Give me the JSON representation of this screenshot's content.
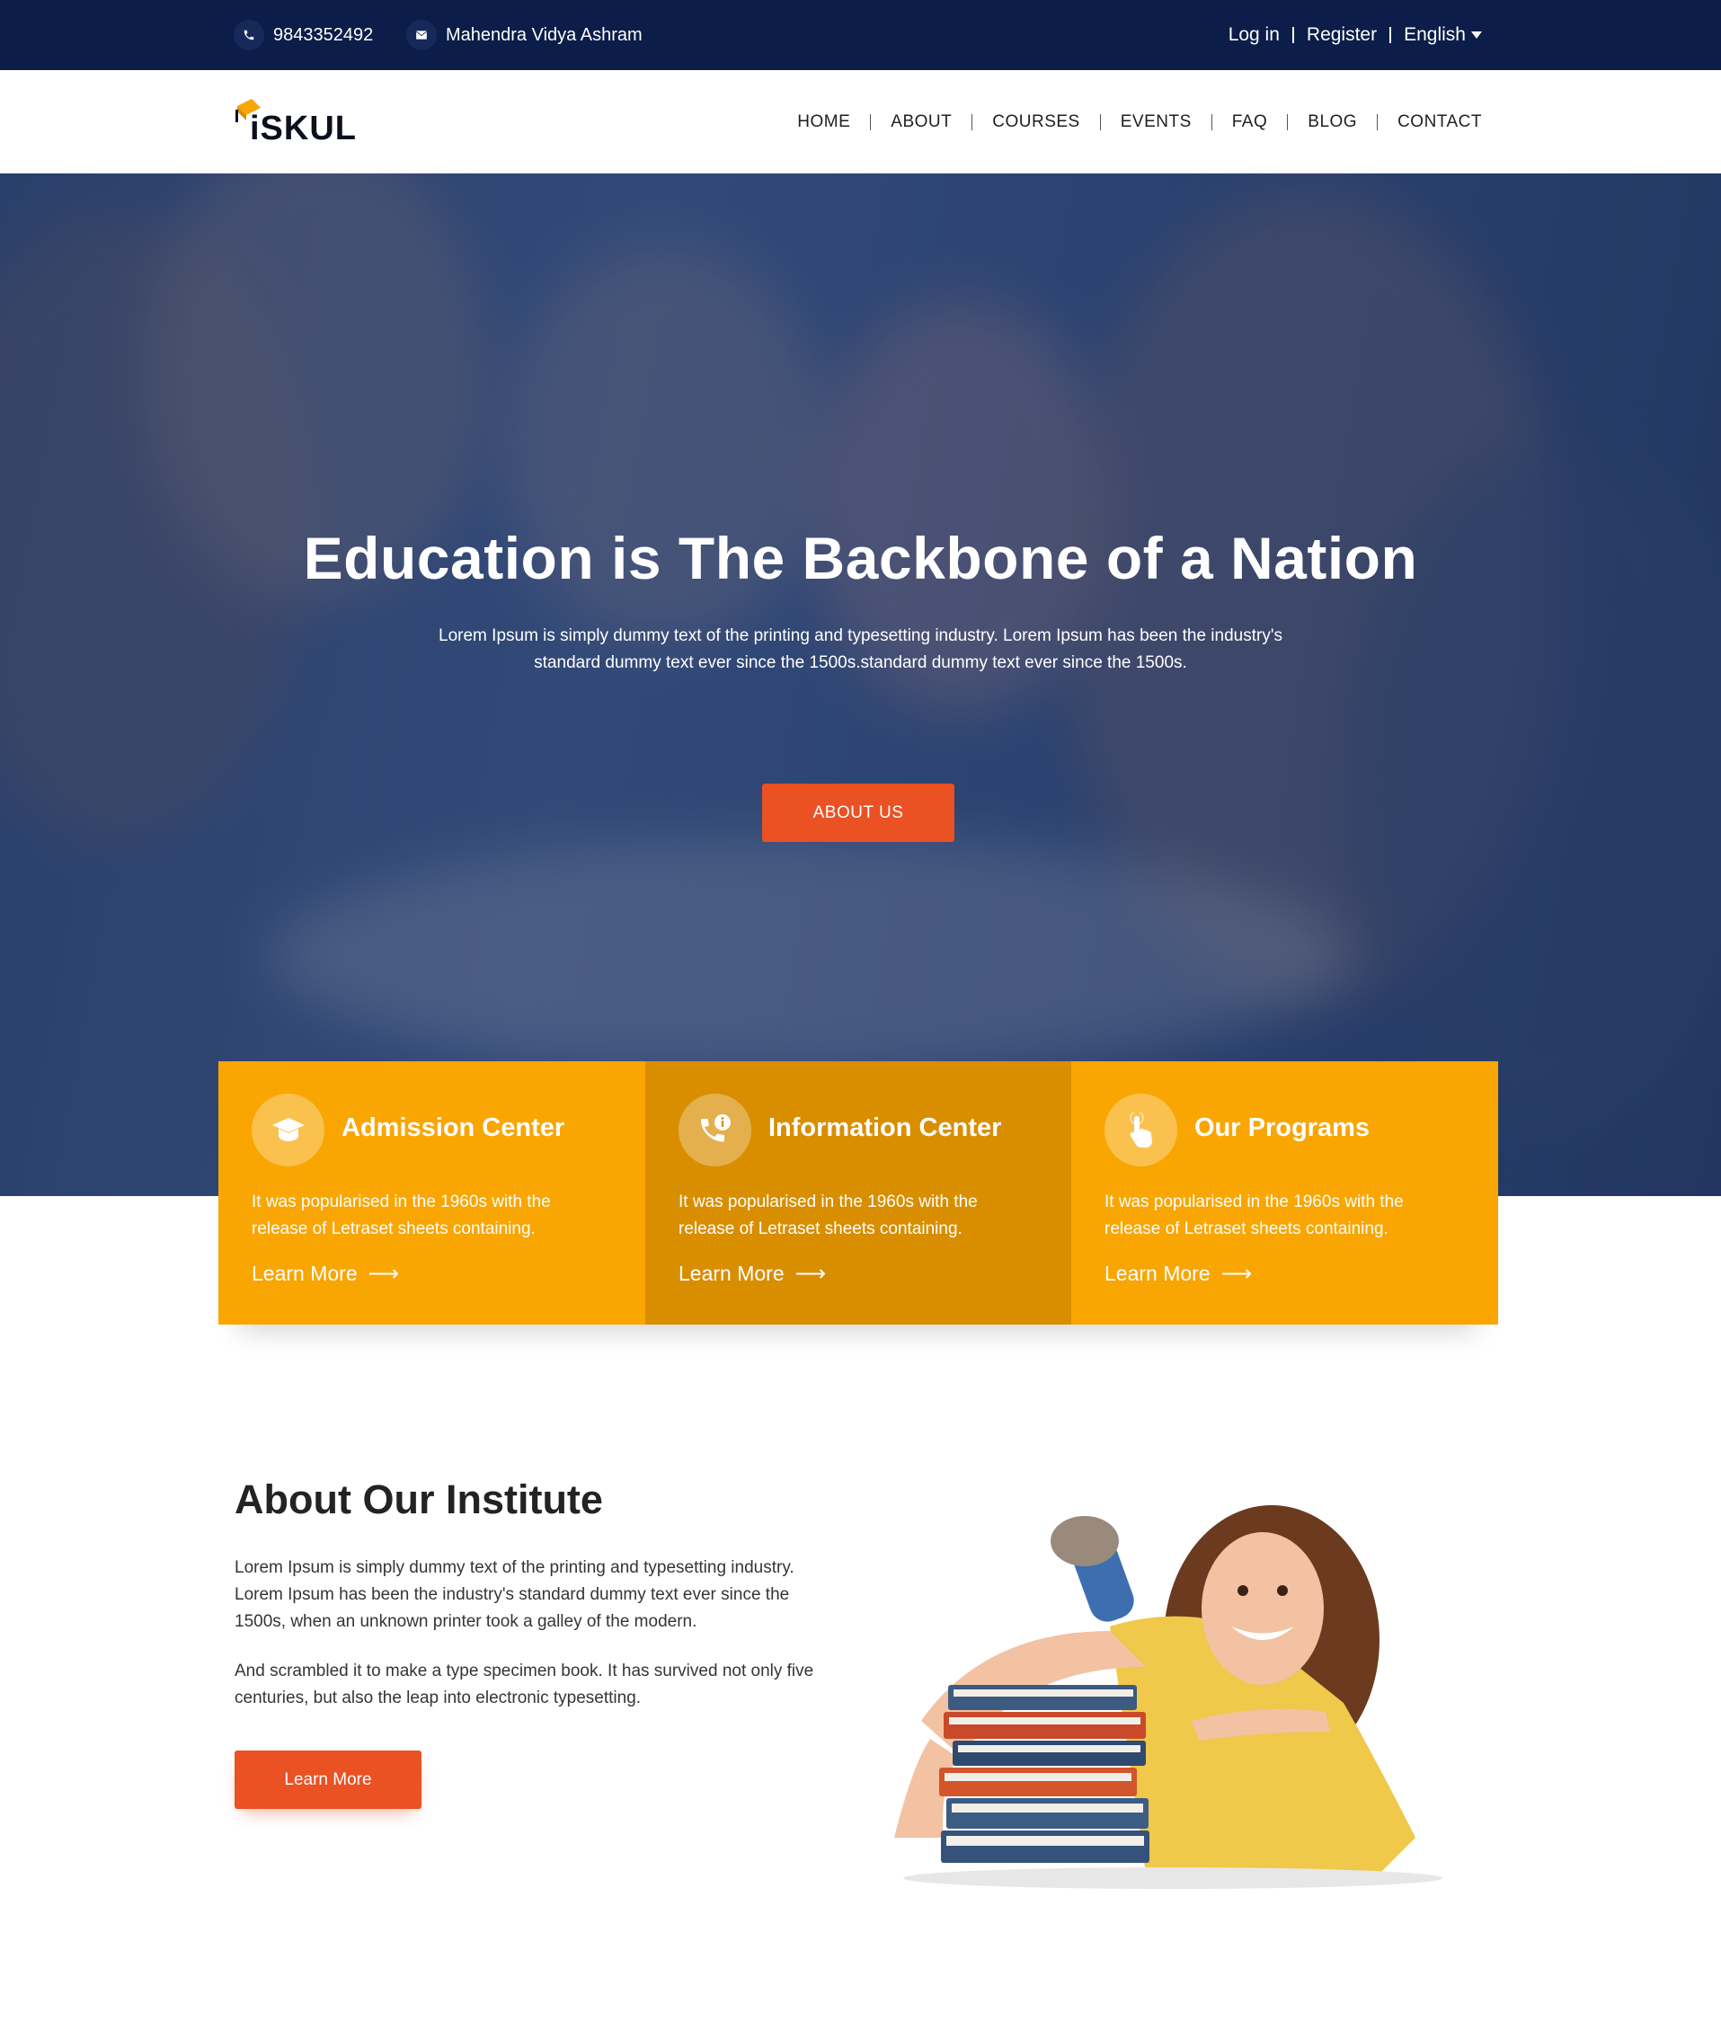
{
  "topbar": {
    "phone": "9843352492",
    "org": "Mahendra Vidya Ashram",
    "login": "Log in",
    "register": "Register",
    "language": "English"
  },
  "nav": {
    "logo": "iSKUL",
    "items": [
      "HOME",
      "ABOUT",
      "COURSES",
      "EVENTS",
      "FAQ",
      "BLOG",
      "CONTACT"
    ]
  },
  "hero": {
    "title": "Education is The Backbone of a Nation",
    "subtitle_line1": "Lorem Ipsum is simply dummy text of the printing and typesetting industry. Lorem Ipsum has been the industry's",
    "subtitle_line2": "standard dummy text ever since the 1500s.standard dummy text ever since the 1500s.",
    "button": "ABOUT US"
  },
  "cards": [
    {
      "title": "Admission Center",
      "line1": "It was popularised in the 1960s with the",
      "line2": "release of Letraset sheets containing.",
      "link": "Learn More",
      "icon": "graduation-cap-icon"
    },
    {
      "title": "Information Center",
      "line1": "It was popularised in the 1960s with the",
      "line2": "release of Letraset sheets containing.",
      "link": "Learn More",
      "icon": "phone-info-icon"
    },
    {
      "title": "Our Programs",
      "line1": "It was popularised in the 1960s with the",
      "line2": "release of Letraset sheets containing.",
      "link": "Learn More",
      "icon": "hand-pointer-icon"
    }
  ],
  "about": {
    "title": "About Our Institute",
    "p1_line1": "Lorem Ipsum is simply dummy text of the printing and typesetting industry.",
    "p1_line2": "Lorem Ipsum has been the industry's standard dummy text ever since the",
    "p1_line3": "1500s, when an unknown printer took a galley of the modern.",
    "p2_line1": "And scrambled it to make a type specimen book. It has survived not only five",
    "p2_line2": "centuries, but also the leap into electronic typesetting.",
    "button": "Learn More"
  },
  "colors": {
    "topbar": "#0b1d48",
    "accent_orange": "#ea5123",
    "card_yellow": "#f9a603",
    "card_dark_yellow": "#d98e00"
  }
}
